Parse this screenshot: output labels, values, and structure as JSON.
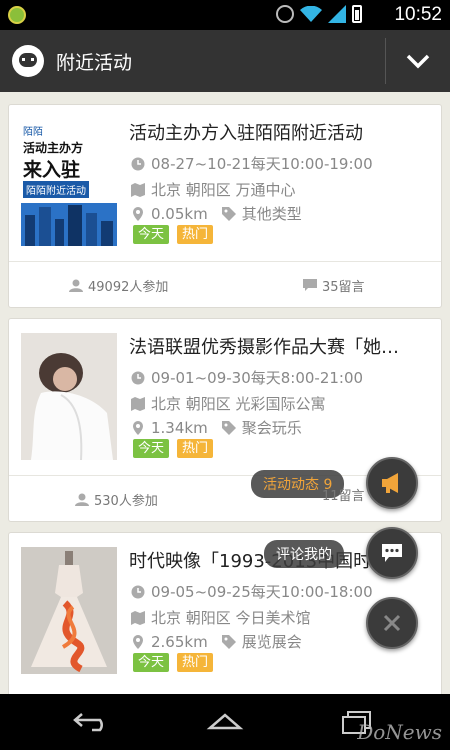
{
  "status_bar": {
    "time": "10:52"
  },
  "header": {
    "title": "附近活动"
  },
  "activities": [
    {
      "title": "活动主办方入驻陌陌附近活动",
      "time": "08-27~10-21每天10:00-19:00",
      "location": "北京 朝阳区 万通中心",
      "distance": "0.05km",
      "category": "其他类型",
      "tags": [
        "今天",
        "热门"
      ],
      "participants": "49092人参加",
      "comments": "35留言",
      "thumb_text": {
        "brand": "陌陌",
        "line1": "活动主办方",
        "line2": "来入驻",
        "line3": "陌陌附近活动"
      }
    },
    {
      "title": "法语联盟优秀摄影作品大赛「她…",
      "time": "09-01~09-30每天8:00-21:00",
      "location": "北京 朝阳区 光彩国际公寓",
      "distance": "1.34km",
      "category": "聚会玩乐",
      "tags": [
        "今天",
        "热门"
      ],
      "participants": "530人参加",
      "comments": ""
    },
    {
      "title": "时代映像「1993-2013中国时…",
      "time": "09-05~09-25每天10:00-18:00",
      "location": "北京 朝阳区 今日美术馆",
      "distance": "2.65km",
      "category": "展览展会",
      "tags": [
        "今天",
        "热门"
      ]
    }
  ],
  "floating": {
    "activity_news": "活动动态 9",
    "comments_mine": "评论我的",
    "peek_comment_count": "11留言"
  },
  "watermark": "DoNews",
  "colors": {
    "accent_green": "#7cc242",
    "accent_orange": "#f5b539",
    "header_bg": "#333333"
  }
}
